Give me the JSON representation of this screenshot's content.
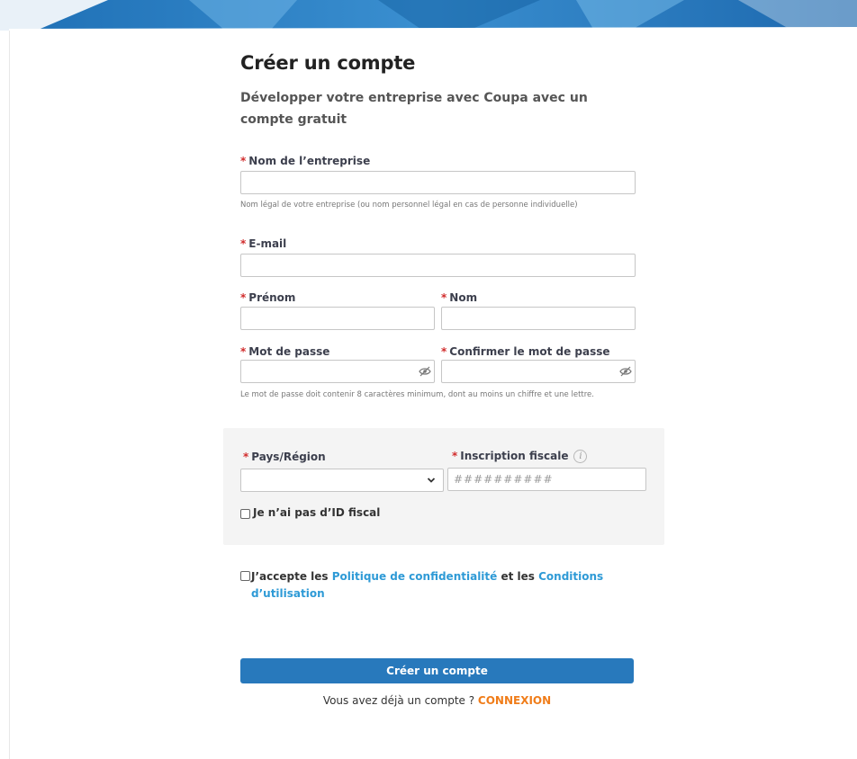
{
  "page": {
    "title": "Créer un compte",
    "subtitle": "Développer votre entreprise avec Coupa avec un compte gratuit"
  },
  "fields": {
    "required_mark": "*",
    "company": {
      "label": "Nom de l’entreprise",
      "value": "",
      "help": "Nom légal de votre entreprise (ou nom personnel légal en cas de personne individuelle)"
    },
    "email": {
      "label": "E-mail",
      "value": ""
    },
    "first_name": {
      "label": "Prénom",
      "value": ""
    },
    "last_name": {
      "label": "Nom",
      "value": ""
    },
    "password": {
      "label": "Mot de passe",
      "value": "",
      "help": "Le mot de passe doit contenir 8 caractères minimum, dont au moins un chiffre et une lettre."
    },
    "confirm_password": {
      "label": "Confirmer le mot de passe",
      "value": ""
    }
  },
  "tax": {
    "country_label": "Pays/Région",
    "country_value": "",
    "tax_id_label": "Inscription fiscale",
    "tax_id_placeholder": "##########",
    "info_icon": "i",
    "no_tax_id_label": "Je n’ai pas d’ID fiscal",
    "no_tax_id_checked": false
  },
  "terms": {
    "prefix": "J’accepte les ",
    "privacy_link": "Politique de confidentialité",
    "middle": " et les ",
    "conditions_link": "Conditions d’utilisation",
    "checked": false
  },
  "actions": {
    "submit_label": "Créer un compte",
    "login_prompt": "Vous avez déjà un compte ? ",
    "login_link": "CONNEXION"
  },
  "icons": {
    "eye": "eye-slash-icon",
    "chevron": "chevron-down-icon",
    "info": "info-icon"
  },
  "colors": {
    "primary_button": "#2879bc",
    "link": "#2e9ad6",
    "login_link": "#f07d1a",
    "required": "#d12c2c",
    "banner": "#2a7fc4"
  }
}
